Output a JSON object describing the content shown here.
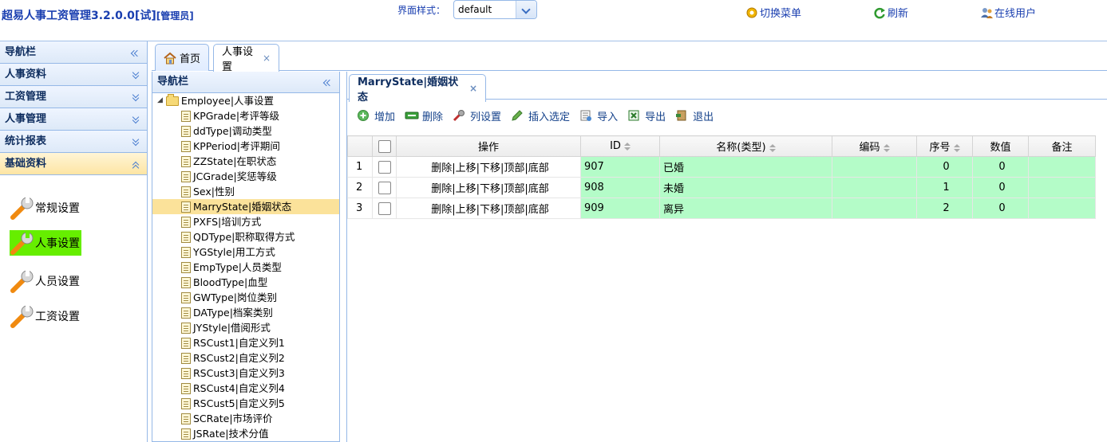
{
  "header": {
    "title": "超易人事工资管理3.2.0.0[试]",
    "role": "[管理员]",
    "style_label": "界面样式：",
    "style_value": "default",
    "links": [
      {
        "label": "切换菜单",
        "icon": "switch-menu-icon"
      },
      {
        "label": "刷新",
        "icon": "refresh-icon"
      },
      {
        "label": "在线用户",
        "icon": "online-users-icon"
      }
    ]
  },
  "leftnav": {
    "title": "导航栏",
    "sections": [
      "人事资料",
      "工资管理",
      "人事管理",
      "统计报表",
      "基础资料"
    ],
    "active_section": "基础资料",
    "items": [
      {
        "label": "常规设置",
        "active": false
      },
      {
        "label": "人事设置",
        "active": true
      },
      {
        "label": "人员设置",
        "active": false
      },
      {
        "label": "工资设置",
        "active": false
      }
    ]
  },
  "tabs": [
    {
      "label": "首页",
      "icon": "home-icon",
      "closable": false
    },
    {
      "label": "人事设置",
      "closable": true
    }
  ],
  "tree": {
    "title": "导航栏",
    "root": "Employee|人事设置",
    "items": [
      "KPGrade|考评等级",
      "ddType|调动类型",
      "KPPeriod|考评期间",
      "ZZState|在职状态",
      "JCGrade|奖惩等级",
      "Sex|性别",
      "MarryState|婚姻状态",
      "PXFS|培训方式",
      "QDType|职称取得方式",
      "YGStyle|用工方式",
      "EmpType|人员类型",
      "BloodType|血型",
      "GWType|岗位类别",
      "DAType|档案类别",
      "JYStyle|借阅形式",
      "RSCust1|自定义列1",
      "RSCust2|自定义列2",
      "RSCust3|自定义列3",
      "RSCust4|自定义列4",
      "RSCust5|自定义列5",
      "SCRate|市场评价",
      "JSRate|技术分值"
    ],
    "selected": "MarryState|婚姻状态"
  },
  "subtab": {
    "label": "MarryState|婚姻状态"
  },
  "toolbar": [
    {
      "label": "增加",
      "icon": "add-icon"
    },
    {
      "label": "删除",
      "icon": "delete-icon"
    },
    {
      "label": "列设置",
      "icon": "column-settings-icon"
    },
    {
      "label": "插入选定",
      "icon": "insert-icon"
    },
    {
      "label": "导入",
      "icon": "import-icon"
    },
    {
      "label": "导出",
      "icon": "export-icon"
    },
    {
      "label": "退出",
      "icon": "exit-icon"
    }
  ],
  "grid": {
    "columns": [
      "操作",
      "ID",
      "名称(类型)",
      "编码",
      "序号",
      "数值",
      "备注"
    ],
    "action_text": "删除|上移|下移|顶部|底部",
    "rows": [
      {
        "num": "1",
        "id": "907",
        "name": "已婚",
        "code": "",
        "seq": "0",
        "value": "0",
        "note": ""
      },
      {
        "num": "2",
        "id": "908",
        "name": "未婚",
        "code": "",
        "seq": "1",
        "value": "0",
        "note": ""
      },
      {
        "num": "3",
        "id": "909",
        "name": "离异",
        "code": "",
        "seq": "2",
        "value": "0",
        "note": ""
      }
    ]
  }
}
